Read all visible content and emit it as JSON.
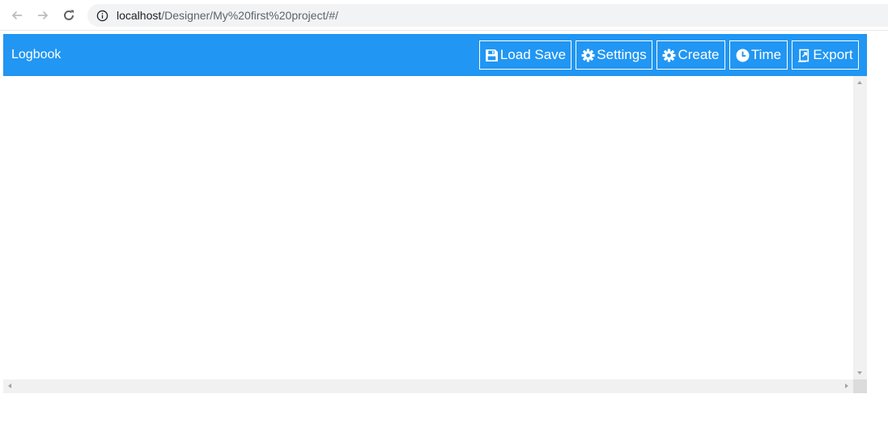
{
  "browser": {
    "url_host": "localhost",
    "url_path": "/Designer/My%20first%20project/#/",
    "icons": {
      "back": "back-arrow-icon",
      "forward": "forward-arrow-icon",
      "reload": "reload-icon",
      "site_info": "info-icon"
    }
  },
  "app": {
    "title": "Logbook",
    "accent_color": "#2196f3",
    "toolbar": [
      {
        "label": "Load Save",
        "icon": "floppy-disk-icon"
      },
      {
        "label": "Settings",
        "icon": "gear-icon"
      },
      {
        "label": "Create",
        "icon": "gear-icon"
      },
      {
        "label": "Time",
        "icon": "clock-icon"
      },
      {
        "label": "Export",
        "icon": "export-document-icon"
      }
    ]
  }
}
